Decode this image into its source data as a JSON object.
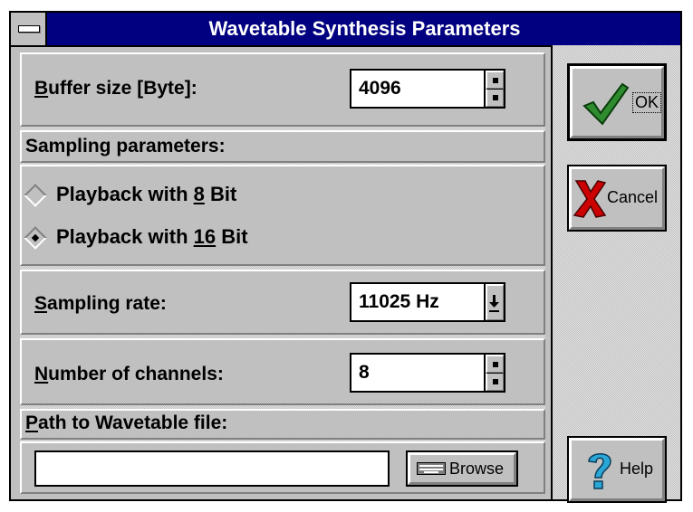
{
  "window": {
    "title": "Wavetable Synthesis Parameters"
  },
  "buffer": {
    "label_pre": "",
    "label_ul": "B",
    "label_post": "uffer size [Byte]:",
    "value": "4096"
  },
  "sampling_params": {
    "heading": "Sampling parameters:"
  },
  "playback": [
    {
      "pre": "Playback with ",
      "ul": "8",
      "post": " Bit",
      "selected": false
    },
    {
      "pre": "Playback with ",
      "ul": "16",
      "post": " Bit",
      "selected": true
    }
  ],
  "rate": {
    "label_ul": "S",
    "label_post": "ampling rate:",
    "value": "11025 Hz"
  },
  "channels": {
    "label_ul": "N",
    "label_post": "umber of channels:",
    "value": "8"
  },
  "path": {
    "label_ul": "P",
    "label_post": "ath to Wavetable file:",
    "value": "",
    "browse_label": "Browse"
  },
  "buttons": {
    "ok": "OK",
    "cancel": "Cancel",
    "help": "Help"
  },
  "colors": {
    "titlebar": "#000080",
    "face": "#c0c0c0",
    "ok_check": "#2e8b2e",
    "cancel_x": "#cc0000",
    "help_q": "#2aa7d6"
  }
}
